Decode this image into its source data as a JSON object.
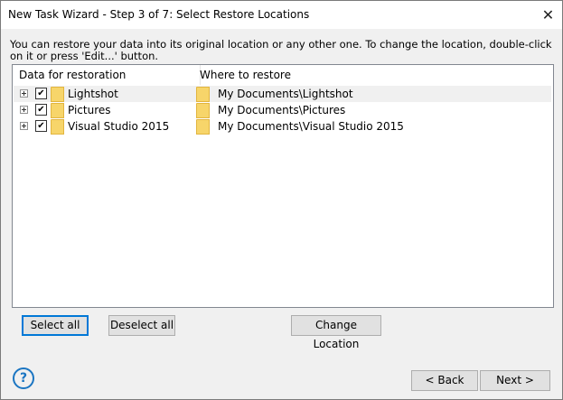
{
  "window": {
    "title": "New Task Wizard - Step 3 of 7: Select Restore Locations",
    "close_glyph": "✕"
  },
  "instructions": "You can restore your data into its original location or any other one. To change the location, double-click on it or press 'Edit...' button.",
  "list": {
    "columns": [
      "Data for restoration",
      "Where to restore"
    ],
    "rows": [
      {
        "name": "Lightshot",
        "destination": "My Documents\\Lightshot",
        "checked": true,
        "selected": true
      },
      {
        "name": "Pictures",
        "destination": "My Documents\\Pictures",
        "checked": true,
        "selected": false
      },
      {
        "name": "Visual Studio 2015",
        "destination": "My Documents\\Visual Studio 2015",
        "checked": true,
        "selected": false
      }
    ],
    "checkmark": "✔"
  },
  "buttons": {
    "select_all": "Select all",
    "deselect_all": "Deselect all",
    "change_location": "Change Location",
    "back": "< Back",
    "next": "Next >"
  },
  "help": {
    "glyph": "?"
  },
  "icons": {
    "folder": "folder-icon",
    "expander": "plus-box-icon",
    "help": "help-circle-icon"
  },
  "colors": {
    "focus_border": "#0078d7",
    "folder_fill": "#f7d56a",
    "help_blue": "#1a75c2"
  }
}
